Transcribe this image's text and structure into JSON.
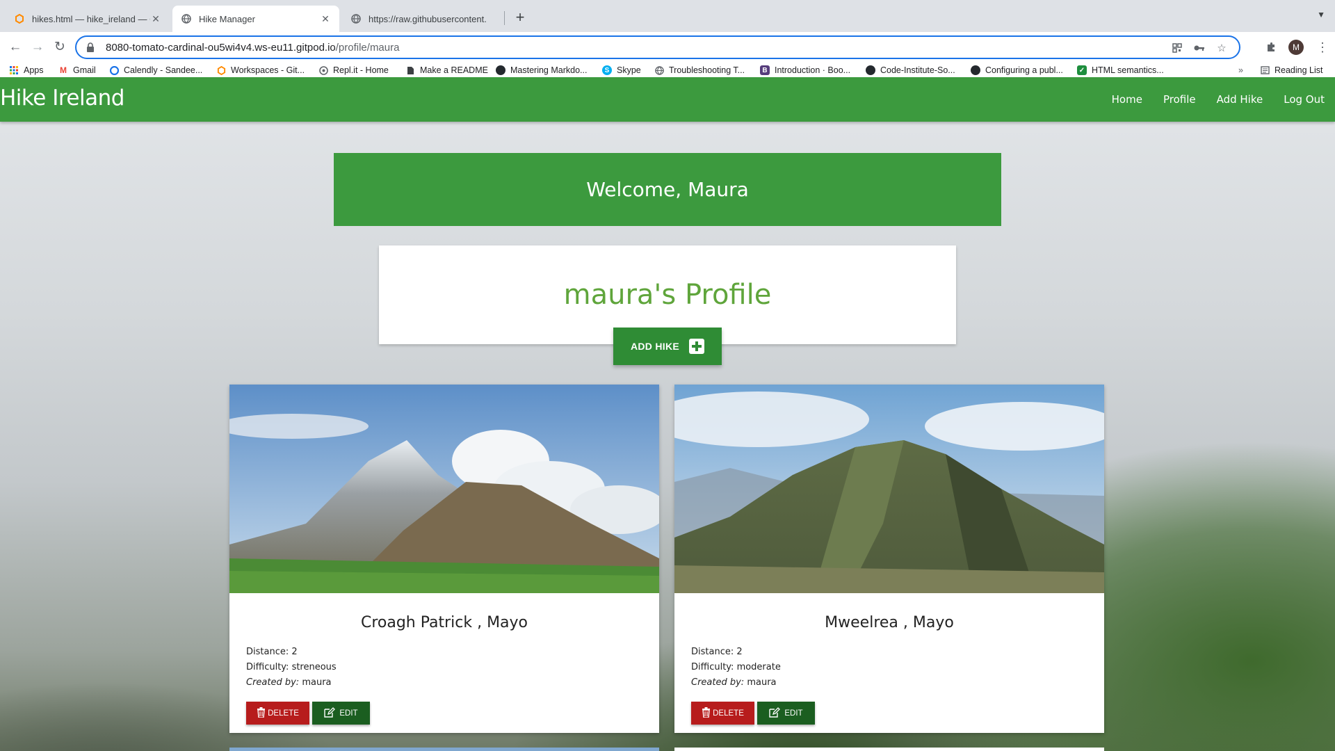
{
  "browser": {
    "tabs": [
      {
        "title": "hikes.html — hike_ireland — Gi",
        "favicon": "gitpod-icon",
        "active": false
      },
      {
        "title": "Hike Manager",
        "favicon": "globe-icon",
        "active": true
      },
      {
        "title": "https://raw.githubusercontent.",
        "favicon": "globe-icon",
        "active": false
      }
    ],
    "url_host": "8080-tomato-cardinal-ou5wi4v4.ws-eu11.gitpod.io",
    "url_path": "/profile/maura",
    "avatar_letter": "M",
    "bookmarks": [
      {
        "label": "Apps",
        "icon": "apps-grid-icon"
      },
      {
        "label": "Gmail",
        "icon": "gmail-icon"
      },
      {
        "label": "Calendly - Sandee...",
        "icon": "calendly-icon"
      },
      {
        "label": "Workspaces - Git...",
        "icon": "gitpod-icon"
      },
      {
        "label": "Repl.it - Home",
        "icon": "replit-icon"
      },
      {
        "label": "Make a README",
        "icon": "document-icon"
      },
      {
        "label": "Mastering Markdo...",
        "icon": "github-icon"
      },
      {
        "label": "Skype",
        "icon": "skype-icon"
      },
      {
        "label": "Troubleshooting T...",
        "icon": "globe-icon"
      },
      {
        "label": "Introduction · Boo...",
        "icon": "bootstrap-icon"
      },
      {
        "label": "Code-Institute-So...",
        "icon": "github-icon"
      },
      {
        "label": "Configuring a publ...",
        "icon": "github-icon"
      },
      {
        "label": "HTML semantics...",
        "icon": "site-icon"
      }
    ],
    "reading_list": "Reading List"
  },
  "site": {
    "brand": "Hike Ireland",
    "nav": [
      "Home",
      "Profile",
      "Add Hike",
      "Log Out"
    ],
    "welcome": "Welcome, Maura",
    "profile_title": "maura's Profile",
    "add_hike_label": "ADD HIKE",
    "hikes": [
      {
        "name": "Croagh Patrick , Mayo",
        "distance_label": "Distance:",
        "distance": "2",
        "difficulty_label": "Difficulty:",
        "difficulty": "streneous",
        "created_label": "Created by:",
        "created_by": "maura",
        "delete_label": "DELETE",
        "edit_label": "EDIT"
      },
      {
        "name": "Mweelrea , Mayo",
        "distance_label": "Distance:",
        "distance": "2",
        "difficulty_label": "Difficulty:",
        "difficulty": "moderate",
        "created_label": "Created by:",
        "created_by": "maura",
        "delete_label": "DELETE",
        "edit_label": "EDIT"
      }
    ]
  },
  "colors": {
    "brand_green": "#3c9a3e",
    "title_green": "#5fa53b",
    "delete_red": "#b71c1c",
    "edit_green": "#1b5e20"
  }
}
